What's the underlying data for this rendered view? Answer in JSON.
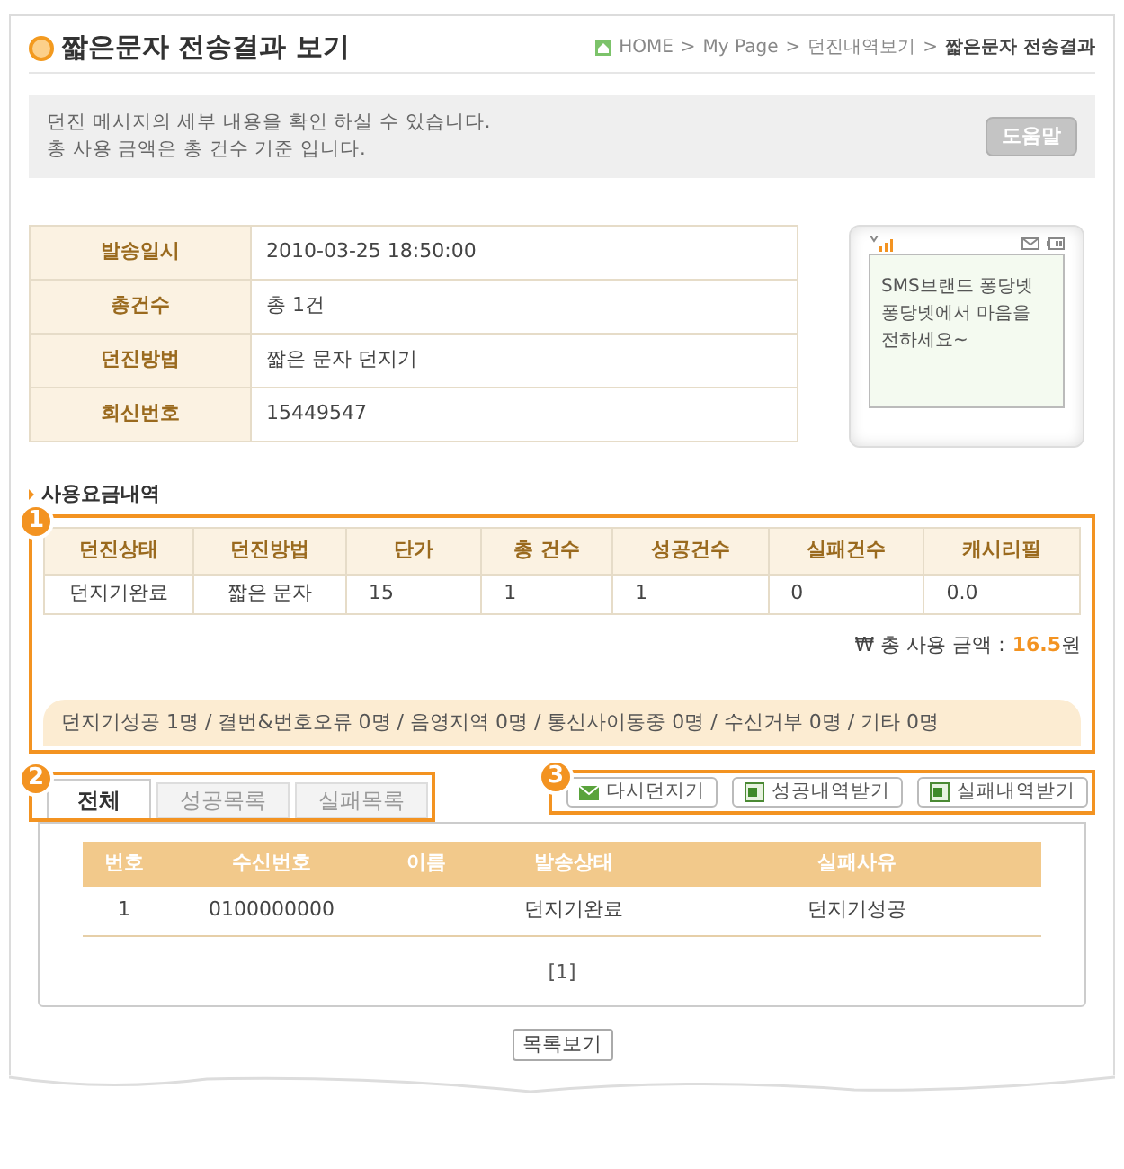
{
  "title": "짧은문자 전송결과 보기",
  "breadcrumb": [
    "HOME",
    "My Page",
    "던진내역보기",
    "짧은문자 전송결과"
  ],
  "breadcrumb_separator": ">",
  "notice": [
    "던진 메시지의 세부 내용을 확인 하실 수 있습니다.",
    "총 사용 금액은 총 건수 기준 입니다."
  ],
  "help_button": "도움말",
  "info": [
    {
      "label": "발송일시",
      "value": "2010-03-25 18:50:00"
    },
    {
      "label": "총건수",
      "value": "총 1건"
    },
    {
      "label": "던진방법",
      "value": "짧은 문자 던지기"
    },
    {
      "label": "회신번호",
      "value": "15449547"
    }
  ],
  "phone_preview": {
    "lines": [
      "SMS브랜드 퐁당넷",
      "퐁당넷에서 마음을",
      "전하세요~"
    ]
  },
  "fee_section": {
    "title": "사용요금내역",
    "callout": "1",
    "columns": [
      "던진상태",
      "던진방법",
      "단가",
      "총 건수",
      "성공건수",
      "실패건수",
      "캐시리필"
    ],
    "rows": [
      [
        "던지기완료",
        "짧은 문자",
        "15",
        "1",
        "1",
        "0",
        "0.0"
      ]
    ],
    "total_label": "₩ 총 사용 금액 :",
    "total_amount": "16.5",
    "total_unit": "원",
    "summary": "던지기성공 1명 / 결번&번호오류 0명 / 음영지역 0명 / 통신사이동중 0명 / 수신거부 0명 / 기타 0명"
  },
  "tabs_callout": "2",
  "tabs": [
    {
      "label": "전체",
      "selected": true
    },
    {
      "label": "성공목록",
      "selected": false
    },
    {
      "label": "실패목록",
      "selected": false
    }
  ],
  "actions_callout": "3",
  "actions": [
    {
      "kind": "mail",
      "label": "다시던지기"
    },
    {
      "kind": "excel",
      "label": "성공내역받기"
    },
    {
      "kind": "excel",
      "label": "실패내역받기"
    }
  ],
  "results": {
    "columns": [
      "번호",
      "수신번호",
      "이름",
      "발송상태",
      "실패사유"
    ],
    "rows": [
      [
        "1",
        "0100000000",
        "",
        "던지기완료",
        "던지기성공"
      ]
    ],
    "pagination": "[1]"
  },
  "list_button": "목록보기"
}
